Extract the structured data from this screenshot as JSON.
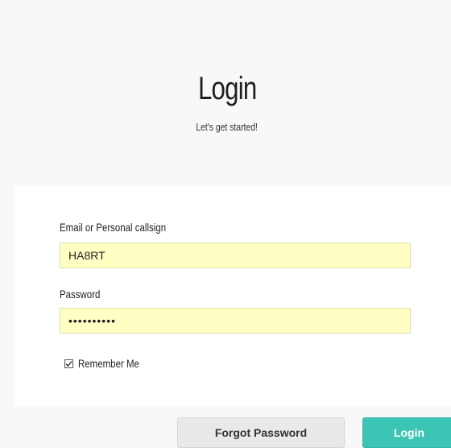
{
  "header": {
    "title": "Login",
    "subtitle": "Let's get started!"
  },
  "form": {
    "email_label": "Email or Personal callsign",
    "email_value": "HA8RT",
    "password_label": "Password",
    "password_value": "••••••••••",
    "remember_label": "Remember Me",
    "remember_checked": true
  },
  "actions": {
    "forgot_label": "Forgot Password",
    "login_label": "Login"
  },
  "colors": {
    "autofill_bg": "#ffffc4",
    "login_button": "#3cc4b4",
    "page_bg": "#f8f8f8"
  }
}
